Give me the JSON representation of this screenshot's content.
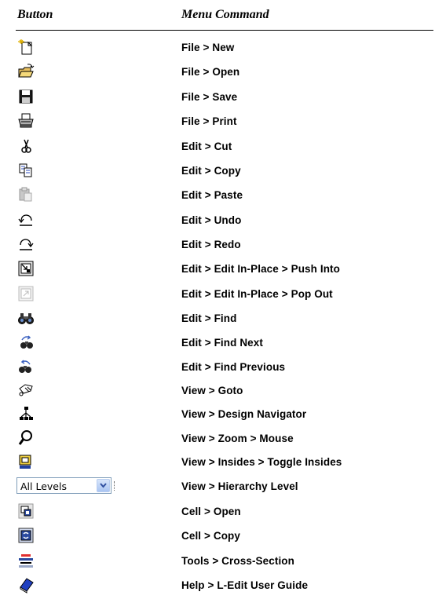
{
  "header": {
    "button_col": "Button",
    "command_col": "Menu Command"
  },
  "rows": [
    {
      "icon": "file-new-icon",
      "command": "File > New"
    },
    {
      "icon": "file-open-icon",
      "command": "File > Open"
    },
    {
      "icon": "file-save-icon",
      "command": "File > Save"
    },
    {
      "icon": "file-print-icon",
      "command": "File > Print"
    },
    {
      "icon": "cut-icon",
      "command": "Edit > Cut"
    },
    {
      "icon": "copy-icon",
      "command": "Edit > Copy"
    },
    {
      "icon": "paste-icon",
      "command": "Edit > Paste"
    },
    {
      "icon": "undo-icon",
      "command": "Edit > Undo"
    },
    {
      "icon": "redo-icon",
      "command": "Edit > Redo"
    },
    {
      "icon": "push-into-icon",
      "command": "Edit > Edit In-Place > Push Into"
    },
    {
      "icon": "pop-out-icon",
      "command": "Edit > Edit In-Place > Pop Out"
    },
    {
      "icon": "find-icon",
      "command": "Edit > Find"
    },
    {
      "icon": "find-next-icon",
      "command": "Edit > Find Next"
    },
    {
      "icon": "find-previous-icon",
      "command": "Edit > Find Previous"
    },
    {
      "icon": "goto-icon",
      "command": "View > Goto"
    },
    {
      "icon": "design-navigator-icon",
      "command": "View > Design Navigator"
    },
    {
      "icon": "zoom-mouse-icon",
      "command": "View > Zoom > Mouse"
    },
    {
      "icon": "toggle-insides-icon",
      "command": "View > Insides > Toggle Insides"
    },
    {
      "icon": "hierarchy-level-combo",
      "command": "View > Hierarchy Level",
      "combo_value": "All Levels"
    },
    {
      "icon": "cell-open-icon",
      "command": "Cell > Open"
    },
    {
      "icon": "cell-copy-icon",
      "command": "Cell > Copy"
    },
    {
      "icon": "cross-section-icon",
      "command": "Tools > Cross-Section"
    },
    {
      "icon": "user-guide-icon",
      "command": "Help > L-Edit User Guide"
    }
  ]
}
